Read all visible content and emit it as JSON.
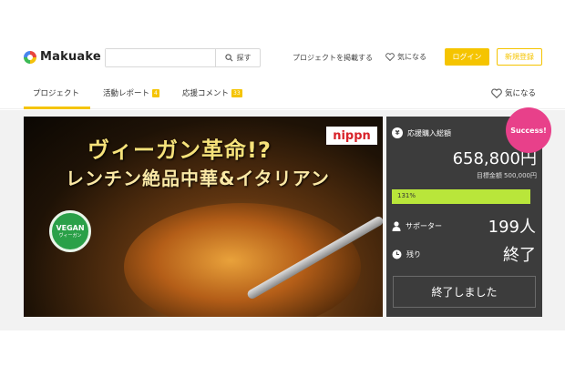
{
  "header": {
    "brand": "Makuake",
    "search_placeholder": "",
    "search_button": "探す",
    "post_project": "プロジェクトを掲載する",
    "favorites": "気になる",
    "login": "ログイン",
    "signup": "新規登録"
  },
  "tabs": {
    "project": "プロジェクト",
    "activity": "活動レポート",
    "activity_count": "4",
    "comments": "応援コメント",
    "comments_count": "33",
    "favorite": "気になる"
  },
  "hero": {
    "title_line1": "ヴィーガン革命!?",
    "title_line2": "レンチン絶品中華&イタリアン",
    "brand_logo": "nippn",
    "badge_main": "VEGAN",
    "badge_sub": "ヴィーガン"
  },
  "stats": {
    "total_label": "応援購入総額",
    "total_value": "658,800円",
    "target": "目標金額 500,000円",
    "progress_label": "131%",
    "progress_fraction": 1.0,
    "supporters_label": "サポーター",
    "supporters_value": "199人",
    "remaining_label": "残り",
    "remaining_value": "終了",
    "status_button": "終了しました",
    "success_badge": "Success!"
  },
  "colors": {
    "accent": "#f5c400",
    "panel": "#3c3c3c",
    "progress": "#b9e63a",
    "success": "#e8408a"
  }
}
